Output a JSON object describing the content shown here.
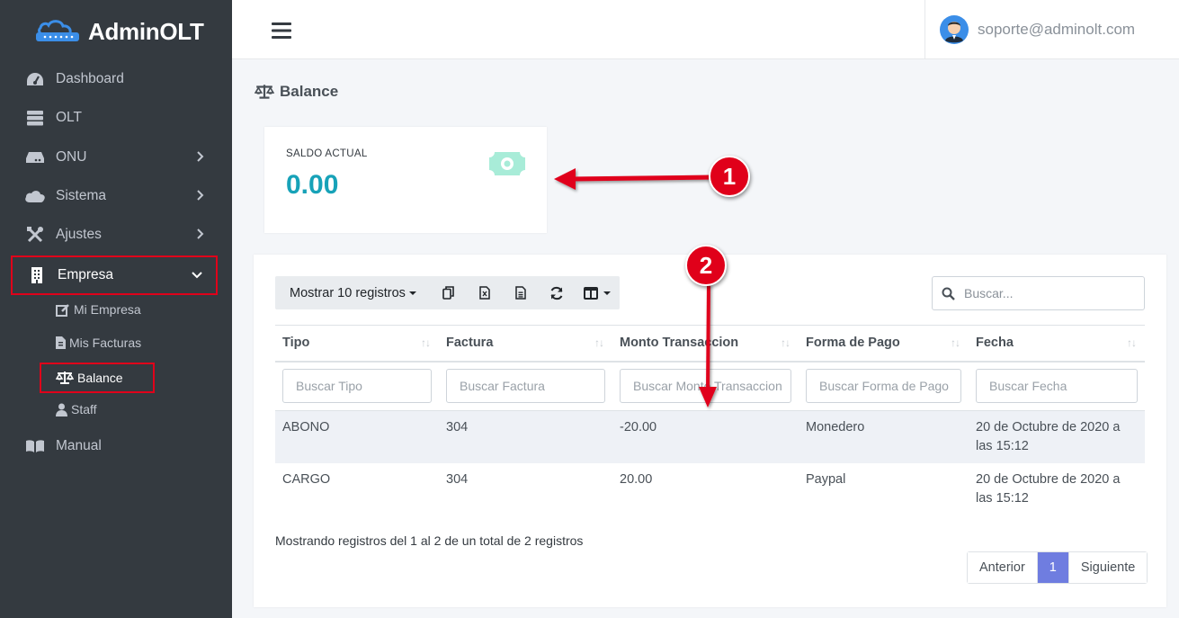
{
  "brand": {
    "name": "AdminOLT"
  },
  "sidebar": {
    "items": [
      {
        "label": "Dashboard"
      },
      {
        "label": "OLT"
      },
      {
        "label": "ONU"
      },
      {
        "label": "Sistema"
      },
      {
        "label": "Ajustes"
      },
      {
        "label": "Empresa"
      },
      {
        "label": "Manual"
      }
    ],
    "sub_items": [
      {
        "label": "Mi Empresa"
      },
      {
        "label": "Mis Facturas"
      },
      {
        "label": "Balance"
      },
      {
        "label": "Staff"
      }
    ]
  },
  "header": {
    "user_email": "soporte@adminolt.com"
  },
  "page": {
    "title": "Balance"
  },
  "info_box": {
    "label": "SALDO ACTUAL",
    "value": "0.00"
  },
  "table": {
    "length_label": "Mostrar 10 registros",
    "search_placeholder": "Buscar...",
    "columns": [
      "Tipo",
      "Factura",
      "Monto Transaccion",
      "Forma de Pago",
      "Fecha"
    ],
    "filter_placeholders": [
      "Buscar Tipo",
      "Buscar Factura",
      "Buscar Monto Transaccion",
      "Buscar Forma de Pago",
      "Buscar Fecha"
    ],
    "rows": [
      [
        "ABONO",
        "304",
        "-20.00",
        "Monedero",
        "20 de Octubre de 2020 a las 15:12"
      ],
      [
        "CARGO",
        "304",
        "20.00",
        "Paypal",
        "20 de Octubre de 2020 a las 15:12"
      ]
    ],
    "info": "Mostrando registros del 1 al 2 de un total de 2 registros"
  },
  "pagination": {
    "prev": "Anterior",
    "current": "1",
    "next": "Siguiente"
  },
  "annotations": {
    "badge1": "1",
    "badge2": "2"
  },
  "colors": {
    "sidebar_bg": "#343a40",
    "accent_value": "#17a2b8",
    "annotation_red": "#e0001a",
    "page_active": "#6f7de0"
  }
}
